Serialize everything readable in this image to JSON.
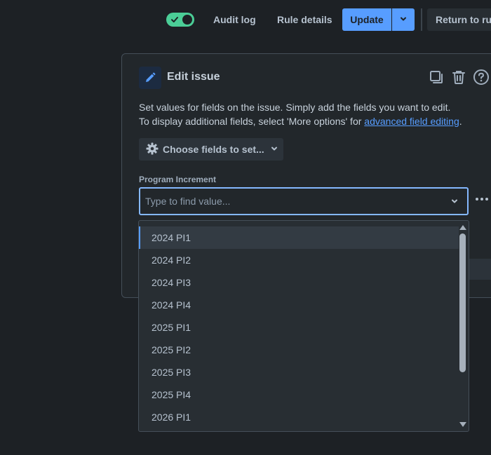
{
  "topbar": {
    "toggle_state": "on",
    "audit_log_label": "Audit log",
    "rule_details_label": "Rule details",
    "update_label": "Update",
    "return_label": "Return to rul"
  },
  "panel": {
    "title": "Edit issue",
    "desc_line1": "Set values for fields on the issue. Simply add the fields you want to edit.",
    "desc_line2_prefix": "To display additional fields, select 'More options' for ",
    "desc_link": "advanced field editing",
    "desc_line2_suffix": ".",
    "choose_fields_label": "Choose fields to set...",
    "field_label": "Program Increment",
    "select_placeholder": "Type to find value..."
  },
  "dropdown": {
    "options": [
      "2024 PI1",
      "2024 PI2",
      "2024 PI3",
      "2024 PI4",
      "2025 PI1",
      "2025 PI2",
      "2025 PI3",
      "2025 PI4",
      "2026 PI1"
    ],
    "active_option": "2024 PI1"
  },
  "colors": {
    "background": "#1d2125",
    "accent": "#579dff",
    "toggle_on": "#4bce97",
    "panel": "#22272b",
    "dropdown": "#282e33"
  },
  "icons": {
    "toggle": "check-icon",
    "update_dropdown": "chevron-down-icon",
    "edit": "pencil-icon",
    "copy": "copy-icon",
    "delete": "trash-icon",
    "help": "question-icon",
    "choose_fields": "gear-icon",
    "more": "more-horizontal-icon"
  }
}
